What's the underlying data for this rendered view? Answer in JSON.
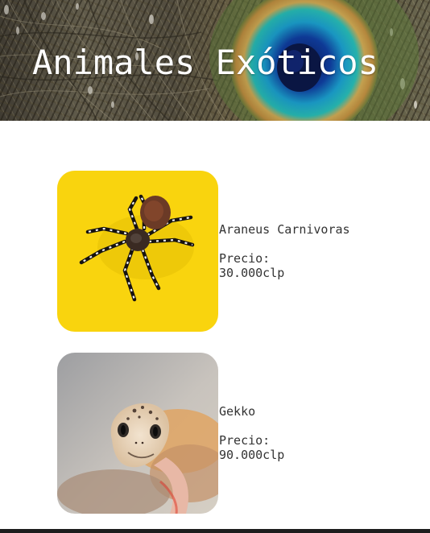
{
  "header": {
    "title": "Animales Exóticos",
    "background_image": "peacock-feather"
  },
  "products": [
    {
      "image": "tarantula-on-yellow",
      "name": "Araneus Carnivoras",
      "price_label": "Precio:",
      "price": "30.000clp"
    },
    {
      "image": "leopard-gecko",
      "name": "Gekko",
      "price_label": "Precio:",
      "price": "90.000clp"
    }
  ],
  "colors": {
    "background": "#ffffff",
    "text": "#333333",
    "title_text": "#ffffff",
    "card_yellow": "#fbd80f",
    "footer": "#1d1d1d"
  }
}
